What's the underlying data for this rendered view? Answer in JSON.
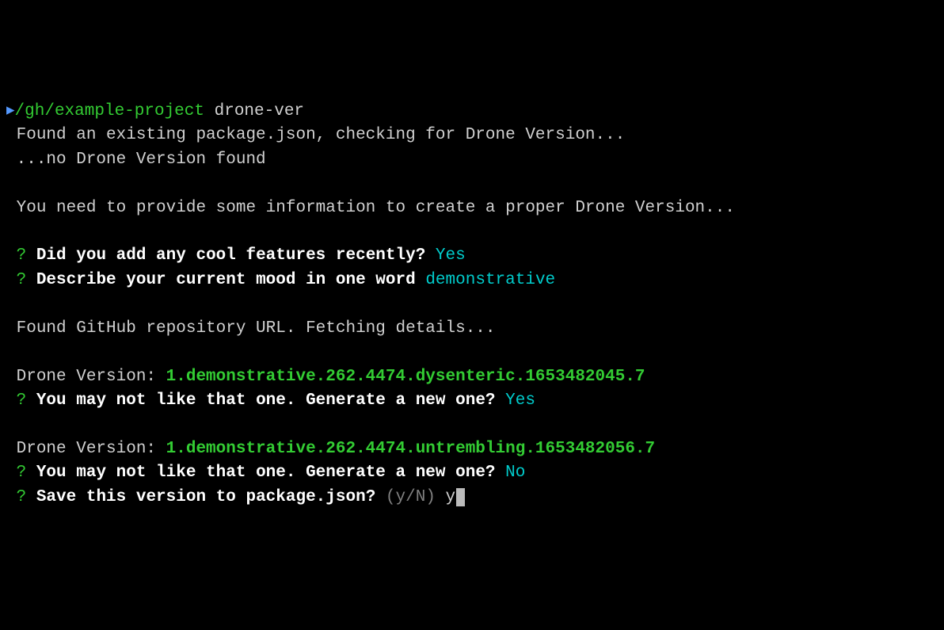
{
  "prompt": {
    "caret": "▸",
    "cwd": "/gh/example-project",
    "command": "drone-ver"
  },
  "msg": {
    "found_pkg": "Found an existing package.json, checking for Drone Version...",
    "no_version": "...no Drone Version found",
    "need_info": "You need to provide some information to create a proper Drone Version...",
    "found_repo": "Found GitHub repository URL. Fetching details...",
    "version_label": "Drone Version: "
  },
  "q": {
    "marker": "?",
    "features": "Did you add any cool features recently?",
    "features_ans": "Yes",
    "mood": "Describe your current mood in one word",
    "mood_ans": "demonstrative",
    "regen1": "You may not like that one. Generate a new one?",
    "regen1_ans": "Yes",
    "regen2": "You may not like that one. Generate a new one?",
    "regen2_ans": "No",
    "save": "Save this version to package.json?",
    "save_hint": "(y/N)",
    "save_input": "y"
  },
  "versions": {
    "v1": "1.demonstrative.262.4474.dysenteric.1653482045.7",
    "v2": "1.demonstrative.262.4474.untrembling.1653482056.7"
  }
}
